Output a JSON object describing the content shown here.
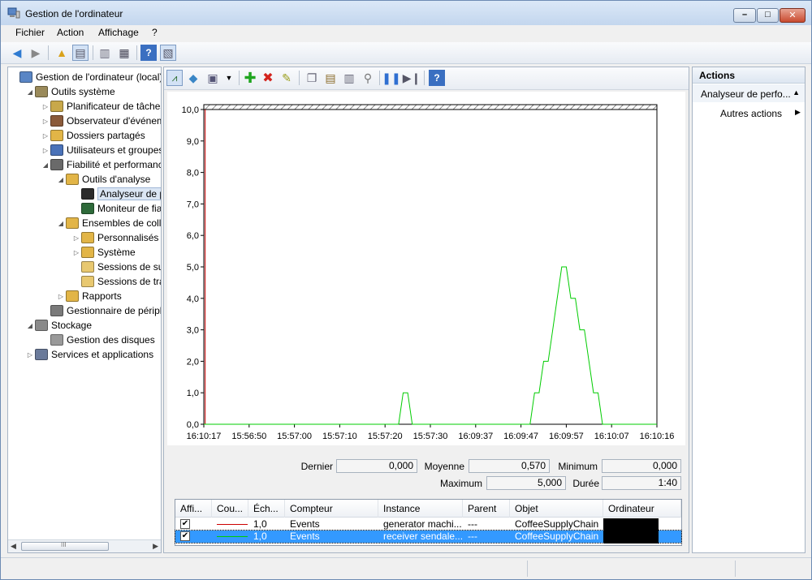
{
  "window": {
    "title": "Gestion de l'ordinateur"
  },
  "menu": [
    "Fichier",
    "Action",
    "Affichage",
    "?"
  ],
  "tree": [
    {
      "label": "Gestion de l'ordinateur (local)",
      "level": 0,
      "arrow": "",
      "icon": "computer-management-icon"
    },
    {
      "label": "Outils système",
      "level": 1,
      "arrow": "down",
      "icon": "tools-icon"
    },
    {
      "label": "Planificateur de tâches",
      "level": 2,
      "arrow": "right",
      "icon": "clock-icon"
    },
    {
      "label": "Observateur d'événeme",
      "level": 2,
      "arrow": "right",
      "icon": "event-viewer-icon"
    },
    {
      "label": "Dossiers partagés",
      "level": 2,
      "arrow": "right",
      "icon": "shared-folder-icon"
    },
    {
      "label": "Utilisateurs et groupes l",
      "level": 2,
      "arrow": "right",
      "icon": "users-icon"
    },
    {
      "label": "Fiabilité et performance",
      "level": 2,
      "arrow": "down",
      "icon": "performance-icon"
    },
    {
      "label": "Outils d'analyse",
      "level": 3,
      "arrow": "down",
      "icon": "folder-icon"
    },
    {
      "label": "Analyseur de per",
      "level": 4,
      "arrow": "",
      "icon": "monitor-icon",
      "selected": true
    },
    {
      "label": "Moniteur de fiab",
      "level": 4,
      "arrow": "",
      "icon": "reliability-icon"
    },
    {
      "label": "Ensembles de collec",
      "level": 3,
      "arrow": "down",
      "icon": "collector-folder-icon"
    },
    {
      "label": "Personnalisés",
      "level": 4,
      "arrow": "right",
      "icon": "user-folder-icon"
    },
    {
      "label": "Système",
      "level": 4,
      "arrow": "right",
      "icon": "system-folder-icon"
    },
    {
      "label": "Sessions de suivi",
      "level": 4,
      "arrow": "",
      "icon": "session-folder-icon"
    },
    {
      "label": "Sessions de trace",
      "level": 4,
      "arrow": "",
      "icon": "session-folder-icon"
    },
    {
      "label": "Rapports",
      "level": 3,
      "arrow": "right",
      "icon": "reports-folder-icon"
    },
    {
      "label": "Gestionnaire de périphé",
      "level": 2,
      "arrow": "",
      "icon": "device-manager-icon"
    },
    {
      "label": "Stockage",
      "level": 1,
      "arrow": "down",
      "icon": "storage-icon"
    },
    {
      "label": "Gestion des disques",
      "level": 2,
      "arrow": "",
      "icon": "disk-icon"
    },
    {
      "label": "Services et applications",
      "level": 1,
      "arrow": "right",
      "icon": "services-icon"
    }
  ],
  "tree_scroll_grip": "III",
  "chart_data": {
    "type": "line",
    "ylim": [
      0,
      10
    ],
    "yticks": [
      "0,0",
      "1,0",
      "2,0",
      "3,0",
      "4,0",
      "5,0",
      "6,0",
      "7,0",
      "8,0",
      "9,0",
      "10,0"
    ],
    "xticks": [
      "16:10:17",
      "15:56:50",
      "15:57:00",
      "15:57:10",
      "15:57:20",
      "15:57:30",
      "16:09:37",
      "16:09:47",
      "16:09:57",
      "16:10:07",
      "16:10:16"
    ],
    "grid": false,
    "series": [
      {
        "name": "generator machi...",
        "color": "#cc0000",
        "x": [
          0.3,
          0.3
        ],
        "y": [
          10,
          0
        ]
      },
      {
        "name": "receiver sendale...",
        "color": "#00cc00",
        "x": [
          0,
          43,
          44,
          45,
          46,
          47,
          72,
          73,
          74,
          75,
          76,
          77,
          78,
          79,
          80,
          81,
          82,
          83,
          84,
          85,
          86,
          87,
          88,
          100
        ],
        "y": [
          0,
          0,
          1,
          1,
          0,
          0,
          0,
          1,
          1,
          2,
          2,
          3,
          4,
          5,
          5,
          4,
          4,
          3,
          3,
          2,
          1,
          1,
          0,
          0
        ]
      }
    ]
  },
  "stats": {
    "dernier_label": "Dernier",
    "dernier": "0,000",
    "moyenne_label": "Moyenne",
    "moyenne": "0,570",
    "minimum_label": "Minimum",
    "minimum": "0,000",
    "maximum_label": "Maximum",
    "maximum": "5,000",
    "duree_label": "Durée",
    "duree": "1:40"
  },
  "counter_table": {
    "headers": [
      "Affi...",
      "Cou...",
      "Éch...",
      "Compteur",
      "Instance",
      "Parent",
      "Objet",
      "Ordinateur"
    ],
    "rows": [
      {
        "checked": "✔",
        "color": "#cc0000",
        "scale": "1,0",
        "counter": "Events",
        "instance": "generator machi...",
        "parent": "---",
        "object": "CoffeeSupplyChain"
      },
      {
        "checked": "✔",
        "color": "#00cc00",
        "scale": "1,0",
        "counter": "Events",
        "instance": "receiver sendale...",
        "parent": "---",
        "object": "CoffeeSupplyChain"
      }
    ]
  },
  "actions": {
    "title": "Actions",
    "subtitle": "Analyseur de perfo...",
    "item": "Autres actions"
  },
  "colors": {
    "accent": "#3399ff",
    "series_red": "#cc0000",
    "series_green": "#00cc00"
  }
}
